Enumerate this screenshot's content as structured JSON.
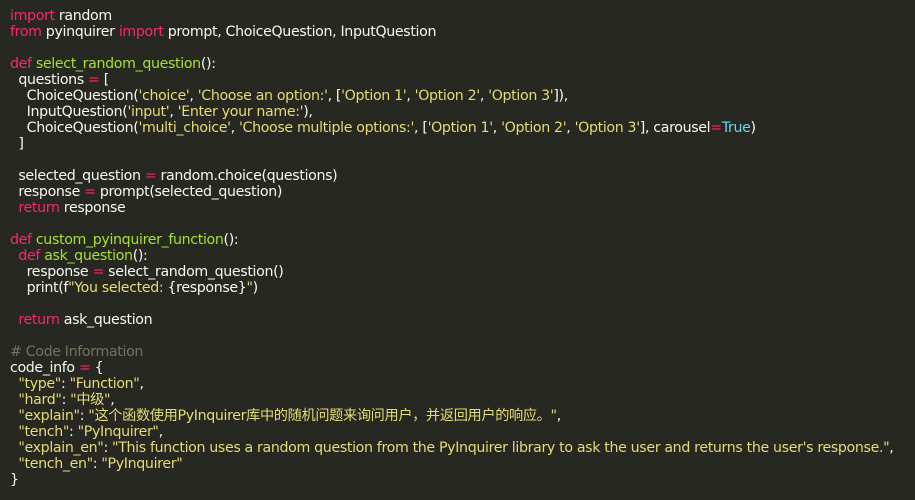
{
  "editor": {
    "colors": {
      "background": "#272822",
      "text": "#f8f8f2",
      "keyword": "#f92672",
      "function": "#a6e22e",
      "string": "#e6db74",
      "builtin": "#66d9ef",
      "comment": "#75715e"
    },
    "lines": [
      [
        [
          "kw",
          "import"
        ],
        [
          "tx",
          " random"
        ]
      ],
      [
        [
          "kw",
          "from"
        ],
        [
          "tx",
          " pyinquirer "
        ],
        [
          "kw",
          "import"
        ],
        [
          "tx",
          " prompt, ChoiceQuestion, InputQuestion"
        ]
      ],
      [],
      [
        [
          "kw",
          "def"
        ],
        [
          "tx",
          " "
        ],
        [
          "fn",
          "select_random_question"
        ],
        [
          "tx",
          "():"
        ]
      ],
      [
        [
          "tx",
          "  questions "
        ],
        [
          "kw",
          "="
        ],
        [
          "tx",
          " ["
        ]
      ],
      [
        [
          "tx",
          "    ChoiceQuestion("
        ],
        [
          "st",
          "'choice'"
        ],
        [
          "tx",
          ", "
        ],
        [
          "st",
          "'Choose an option:'"
        ],
        [
          "tx",
          ", ["
        ],
        [
          "st",
          "'Option 1'"
        ],
        [
          "tx",
          ", "
        ],
        [
          "st",
          "'Option 2'"
        ],
        [
          "tx",
          ", "
        ],
        [
          "st",
          "'Option 3'"
        ],
        [
          "tx",
          "]),"
        ]
      ],
      [
        [
          "tx",
          "    InputQuestion("
        ],
        [
          "st",
          "'input'"
        ],
        [
          "tx",
          ", "
        ],
        [
          "st",
          "'Enter your name:'"
        ],
        [
          "tx",
          "),"
        ]
      ],
      [
        [
          "tx",
          "    ChoiceQuestion("
        ],
        [
          "st",
          "'multi_choice'"
        ],
        [
          "tx",
          ", "
        ],
        [
          "st",
          "'Choose multiple options:'"
        ],
        [
          "tx",
          ", ["
        ],
        [
          "st",
          "'Option 1'"
        ],
        [
          "tx",
          ", "
        ],
        [
          "st",
          "'Option 2'"
        ],
        [
          "tx",
          ", "
        ],
        [
          "st",
          "'Option 3'"
        ],
        [
          "tx",
          "], carousel"
        ],
        [
          "kw",
          "="
        ],
        [
          "bi",
          "True"
        ],
        [
          "tx",
          ")"
        ]
      ],
      [
        [
          "tx",
          "  ]"
        ]
      ],
      [],
      [
        [
          "tx",
          "  selected_question "
        ],
        [
          "kw",
          "="
        ],
        [
          "tx",
          " random.choice(questions)"
        ]
      ],
      [
        [
          "tx",
          "  response "
        ],
        [
          "kw",
          "="
        ],
        [
          "tx",
          " prompt(selected_question)"
        ]
      ],
      [
        [
          "tx",
          "  "
        ],
        [
          "kw",
          "return"
        ],
        [
          "tx",
          " response"
        ]
      ],
      [],
      [
        [
          "kw",
          "def"
        ],
        [
          "tx",
          " "
        ],
        [
          "fn",
          "custom_pyinquirer_function"
        ],
        [
          "tx",
          "():"
        ]
      ],
      [
        [
          "tx",
          "  "
        ],
        [
          "kw",
          "def"
        ],
        [
          "tx",
          " "
        ],
        [
          "fn",
          "ask_question"
        ],
        [
          "tx",
          "():"
        ]
      ],
      [
        [
          "tx",
          "    response "
        ],
        [
          "kw",
          "="
        ],
        [
          "tx",
          " select_random_question()"
        ]
      ],
      [
        [
          "tx",
          "    print(f"
        ],
        [
          "st",
          "\"You selected: "
        ],
        [
          "tx",
          "{response}"
        ],
        [
          "st",
          "\""
        ],
        [
          "tx",
          ")"
        ]
      ],
      [],
      [
        [
          "tx",
          "  "
        ],
        [
          "kw",
          "return"
        ],
        [
          "tx",
          " ask_question"
        ]
      ],
      [],
      [
        [
          "cm",
          "# Code Information"
        ]
      ],
      [
        [
          "tx",
          "code_info "
        ],
        [
          "kw",
          "="
        ],
        [
          "tx",
          " {"
        ]
      ],
      [
        [
          "tx",
          "  "
        ],
        [
          "st",
          "\"type\""
        ],
        [
          "tx",
          ": "
        ],
        [
          "st",
          "\"Function\""
        ],
        [
          "tx",
          ","
        ]
      ],
      [
        [
          "tx",
          "  "
        ],
        [
          "st",
          "\"hard\""
        ],
        [
          "tx",
          ": "
        ],
        [
          "st",
          "\"中级\""
        ],
        [
          "tx",
          ","
        ]
      ],
      [
        [
          "tx",
          "  "
        ],
        [
          "st",
          "\"explain\""
        ],
        [
          "tx",
          ": "
        ],
        [
          "st",
          "\"这个函数使用PyInquirer库中的随机问题来询问用户，并返回用户的响应。\""
        ],
        [
          "tx",
          ","
        ]
      ],
      [
        [
          "tx",
          "  "
        ],
        [
          "st",
          "\"tench\""
        ],
        [
          "tx",
          ": "
        ],
        [
          "st",
          "\"PyInquirer\""
        ],
        [
          "tx",
          ","
        ]
      ],
      [
        [
          "tx",
          "  "
        ],
        [
          "st",
          "\"explain_en\""
        ],
        [
          "tx",
          ": "
        ],
        [
          "st",
          "\"This function uses a random question from the PyInquirer library to ask the user and returns the user's response.\""
        ],
        [
          "tx",
          ","
        ]
      ],
      [
        [
          "tx",
          "  "
        ],
        [
          "st",
          "\"tench_en\""
        ],
        [
          "tx",
          ": "
        ],
        [
          "st",
          "\"PyInquirer\""
        ]
      ],
      [
        [
          "tx",
          "}"
        ]
      ]
    ]
  }
}
